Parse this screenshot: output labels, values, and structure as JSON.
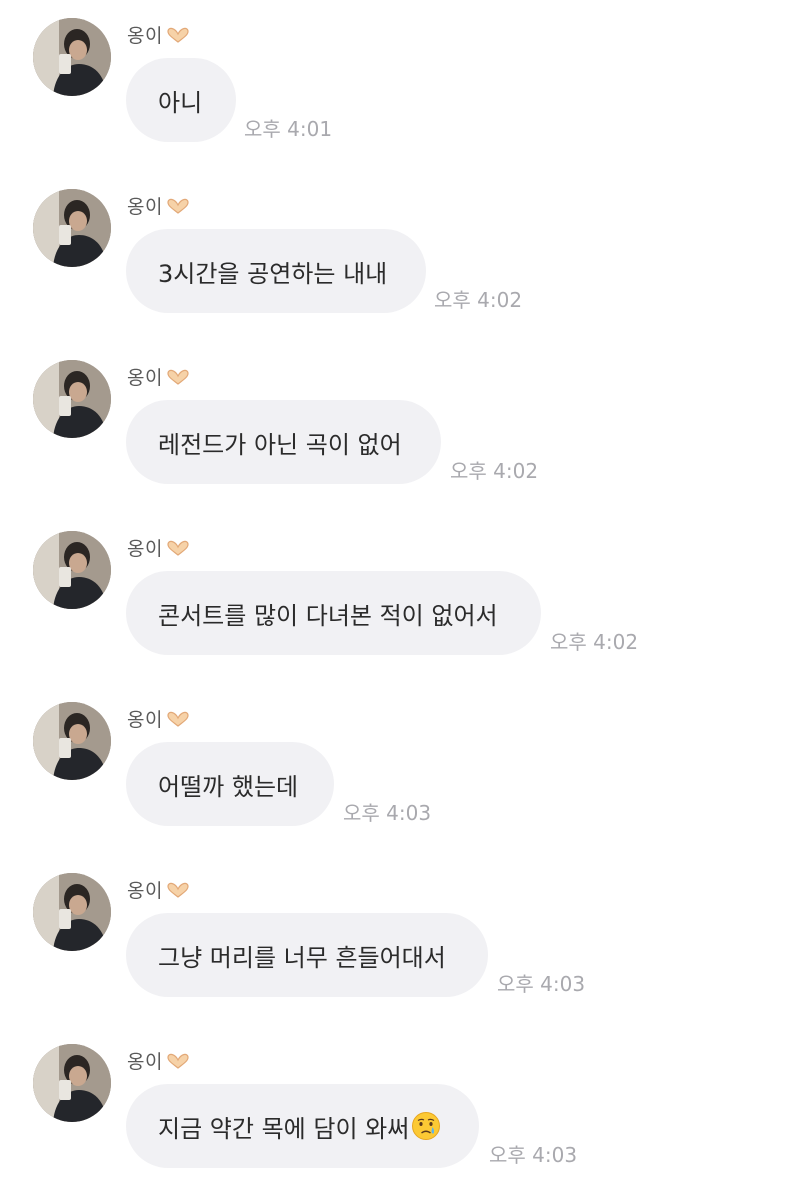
{
  "messages": [
    {
      "sender": "옹이",
      "text": "아니",
      "time": "오후 4:01"
    },
    {
      "sender": "옹이",
      "text": "3시간을 공연하는 내내",
      "time": "오후 4:02"
    },
    {
      "sender": "옹이",
      "text": "레전드가 아닌 곡이 없어",
      "time": "오후 4:02"
    },
    {
      "sender": "옹이",
      "text": "콘서트를 많이 다녀본 적이 없어서",
      "time": "오후 4:02"
    },
    {
      "sender": "옹이",
      "text": "어떨까 했는데",
      "time": "오후 4:03"
    },
    {
      "sender": "옹이",
      "text": "그냥 머리를 너무 흔들어대서",
      "time": "오후 4:03"
    },
    {
      "sender": "옹이",
      "text": "지금 약간 목에 담이 와써",
      "time": "오후 4:03",
      "trailing_icon": "crying-face-icon"
    }
  ],
  "colors": {
    "bubble": "#f1f1f4",
    "text": "#2b2b2b",
    "sender": "#5a5a5a",
    "time": "#a9a9ae"
  }
}
